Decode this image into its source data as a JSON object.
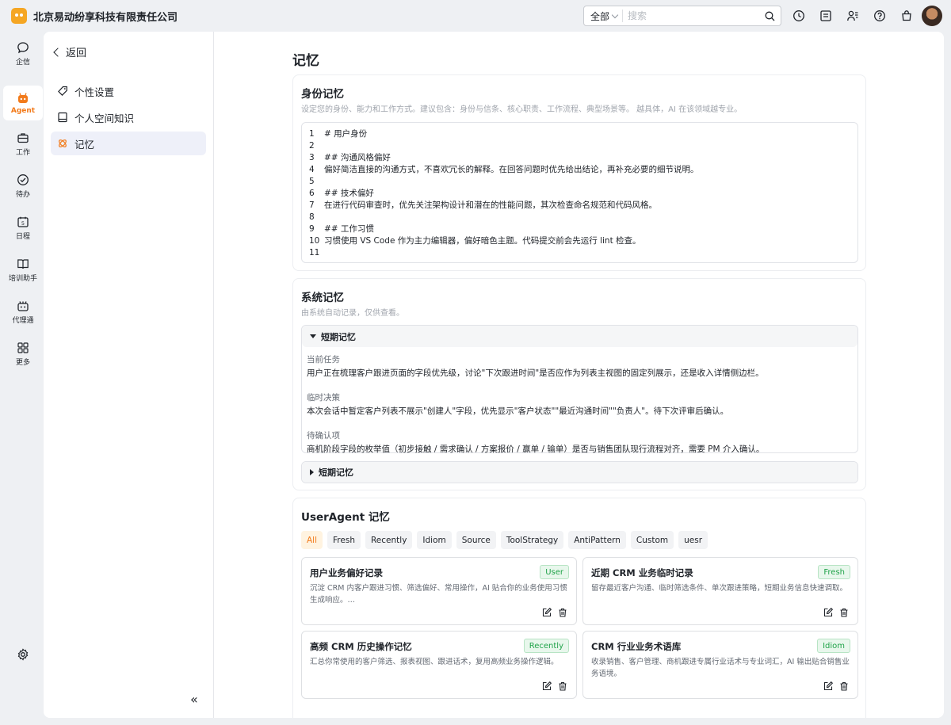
{
  "company": "北京易动纷享科技有限责任公司",
  "search": {
    "scope": "全部",
    "placeholder": "搜索"
  },
  "rail": [
    {
      "label": "企信",
      "icon": "chat-icon"
    },
    {
      "label": "Agent",
      "icon": "agent-icon"
    },
    {
      "label": "工作",
      "icon": "briefcase-icon"
    },
    {
      "label": "待办",
      "icon": "check-circle-icon"
    },
    {
      "label": "日程",
      "icon": "calendar-icon"
    },
    {
      "label": "培训助手",
      "icon": "book-icon"
    },
    {
      "label": "代理通",
      "icon": "agent-connect-icon"
    },
    {
      "label": "更多",
      "icon": "grid-icon"
    }
  ],
  "subnav": {
    "back_label": "返回",
    "items": [
      {
        "label": "个性设置",
        "icon": "tag-icon"
      },
      {
        "label": "个人空间知识",
        "icon": "notebook-icon"
      },
      {
        "label": "记忆",
        "icon": "memory-icon"
      }
    ],
    "collapse": "«"
  },
  "page_title": "记忆",
  "identity": {
    "title": "身份记忆",
    "desc": "设定您的身份、能力和工作方式。建议包含：身份与信条、核心职责、工作流程、典型场景等。 越具体，AI 在该领域越专业。",
    "lines": [
      {
        "n": "1",
        "text": "# 用户身份"
      },
      {
        "n": "2",
        "text": ""
      },
      {
        "n": "3",
        "text": "## 沟通风格偏好"
      },
      {
        "n": "4",
        "text": "偏好简洁直接的沟通方式，不喜欢冗长的解释。在回答问题时优先给出结论，再补充必要的细节说明。"
      },
      {
        "n": "5",
        "text": ""
      },
      {
        "n": "6",
        "text": "## 技术偏好"
      },
      {
        "n": "7",
        "text": "在进行代码审查时，优先关注架构设计和潜在的性能问题，其次检查命名规范和代码风格。"
      },
      {
        "n": "8",
        "text": ""
      },
      {
        "n": "9",
        "text": "## 工作习惯"
      },
      {
        "n": "10",
        "text": "习惯使用 VS Code 作为主力编辑器，偏好暗色主题。代码提交前会先运行 lint 检查。"
      },
      {
        "n": "11",
        "text": ""
      }
    ]
  },
  "system": {
    "title": "系统记忆",
    "desc": "由系统自动记录，仅供查看。",
    "short_term": {
      "title": "短期记忆",
      "entries": [
        {
          "label": "当前任务",
          "text": "用户正在梳理客户跟进页面的字段优先级，讨论\"下次跟进时间\"是否应作为列表主视图的固定列展示，还是收入详情侧边栏。"
        },
        {
          "label": "临时决策",
          "text": "本次会话中暂定客户列表不展示\"创建人\"字段，优先显示\"客户状态\"\"最近沟通时间\"\"负责人\"。待下次评审后确认。"
        },
        {
          "label": "待确认项",
          "text": "商机阶段字段的枚举值（初步接触 / 需求确认 / 方案报价 / 赢单 / 输单）是否与销售团队现行流程对齐，需要 PM 介入确认。"
        }
      ]
    },
    "collapsed_title": "短期记忆"
  },
  "useragent": {
    "title": "UserAgent 记忆",
    "filters": [
      "All",
      "Fresh",
      "Recently",
      "Idiom",
      "Source",
      "ToolStrategy",
      "AntiPattern",
      "Custom",
      "uesr"
    ],
    "cards": [
      {
        "title": "用户业务偏好记录",
        "tag": "User",
        "desc": "沉淀 CRM 内客户跟进习惯、筛选偏好、常用操作，AI 贴合你的业务使用习惯生成响应。…"
      },
      {
        "title": "近期 CRM 业务临时记录",
        "tag": "Fresh",
        "desc": "留存最近客户沟通、临时筛选条件、单次跟进策略，短期业务信息快速调取。"
      },
      {
        "title": "高频 CRM 历史操作记忆",
        "tag": "Recently",
        "desc": "汇总你常使用的客户筛选、报表视图、跟进话术，复用高频业务操作逻辑。"
      },
      {
        "title": "CRM 行业业务术语库",
        "tag": "Idiom",
        "desc": "收录销售、客户管理、商机跟进专属行业话术与专业词汇，AI 输出贴合销售业务语境。"
      }
    ]
  },
  "colors": {
    "accent": "#f27a1a",
    "tag_green": "#21a34a"
  }
}
